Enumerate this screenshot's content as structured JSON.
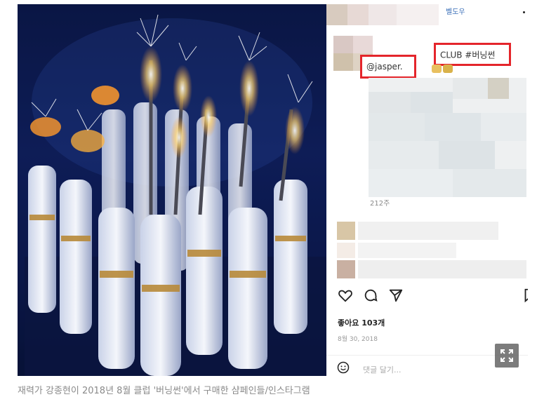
{
  "post": {
    "top_name": "벨도우",
    "tag_mention": "@jasper.",
    "tag_club": "CLUB #버닝썬",
    "reply_count": "212주",
    "likes": "좋아요 103개",
    "date": "8월 30, 2018",
    "comment_placeholder": "댓글 달기..."
  },
  "icons": [
    "heart-icon",
    "comment-icon",
    "send-icon",
    "bookmark-icon",
    "emoji-icon",
    "expand-icon"
  ],
  "caption": "재력가 강종현이 2018년 8월 클럽 '버닝썬'에서 구매한 샴페인들/인스타그램",
  "colors": {
    "highlight_box": "#e4252b",
    "caption": "#8a8a8a",
    "link": "#3b6fb8"
  }
}
